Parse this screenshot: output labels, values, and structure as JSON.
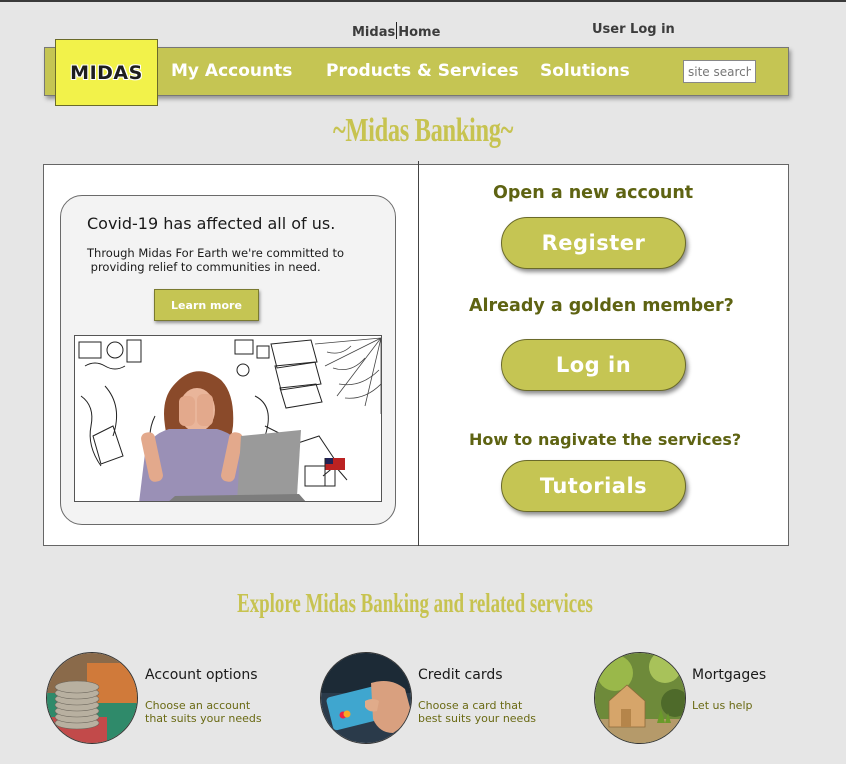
{
  "top_links": {
    "home_left": "Midas",
    "home_right": "Home",
    "user_login": "User Log in"
  },
  "logo": "MIDAS",
  "nav": {
    "items": [
      "My Accounts",
      "Products & Services",
      "Solutions"
    ],
    "search_placeholder": "site search"
  },
  "title": "~Midas Banking~",
  "covid": {
    "title": "Covid-19 has affected all of us.",
    "text_line1": "Through Midas For Earth we're committed to",
    "text_line2": " providing relief to communities in need.",
    "button": "Learn more"
  },
  "right": {
    "open_heading": "Open a new account",
    "register_label": "Register",
    "member_heading": "Already a golden member?",
    "login_label": "Log in",
    "navigate_heading": "How to nagivate the services?",
    "tutorials_label": "Tutorials"
  },
  "explore_title": "Explore Midas Banking and related services",
  "services": [
    {
      "title": "Account options",
      "line1": "Choose an account",
      "line2": "that suits your needs"
    },
    {
      "title": "Credit cards",
      "line1": "Choose a card that",
      "line2": "best suits your needs"
    },
    {
      "title": "Mortgages",
      "line1": "Let us help",
      "line2": ""
    }
  ],
  "colors": {
    "accent": "#c5c553",
    "logo_bg": "#f2f24a",
    "heading_olive": "#5e6312",
    "title_gold": "#c7c350"
  }
}
